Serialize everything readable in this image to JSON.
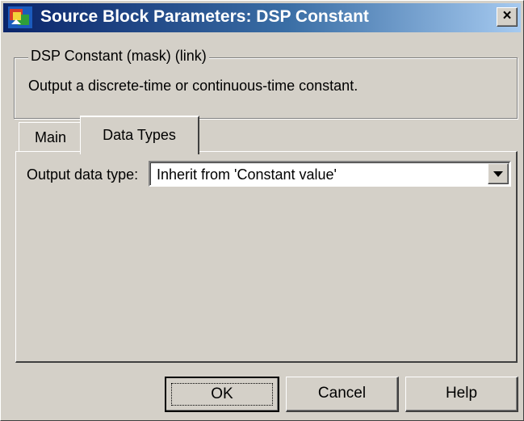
{
  "window": {
    "title": "Source Block Parameters: DSP Constant",
    "close_glyph": "×"
  },
  "group": {
    "legend": "DSP Constant (mask) (link)",
    "description": "Output a discrete-time or continuous-time constant."
  },
  "tabs": [
    {
      "label": "Main",
      "active": false
    },
    {
      "label": "Data Types",
      "active": true
    }
  ],
  "data_types": {
    "output_label": "Output data type:",
    "output_value": "Inherit from 'Constant value'"
  },
  "buttons": {
    "ok": "OK",
    "cancel": "Cancel",
    "help": "Help"
  },
  "icons": {
    "title_icon": "simulink-block-icon",
    "dropdown_icon": "chevron-down-icon"
  },
  "colors": {
    "titlebar_start": "#0a246a",
    "titlebar_end": "#a6caf0",
    "face": "#d4d0c8"
  }
}
